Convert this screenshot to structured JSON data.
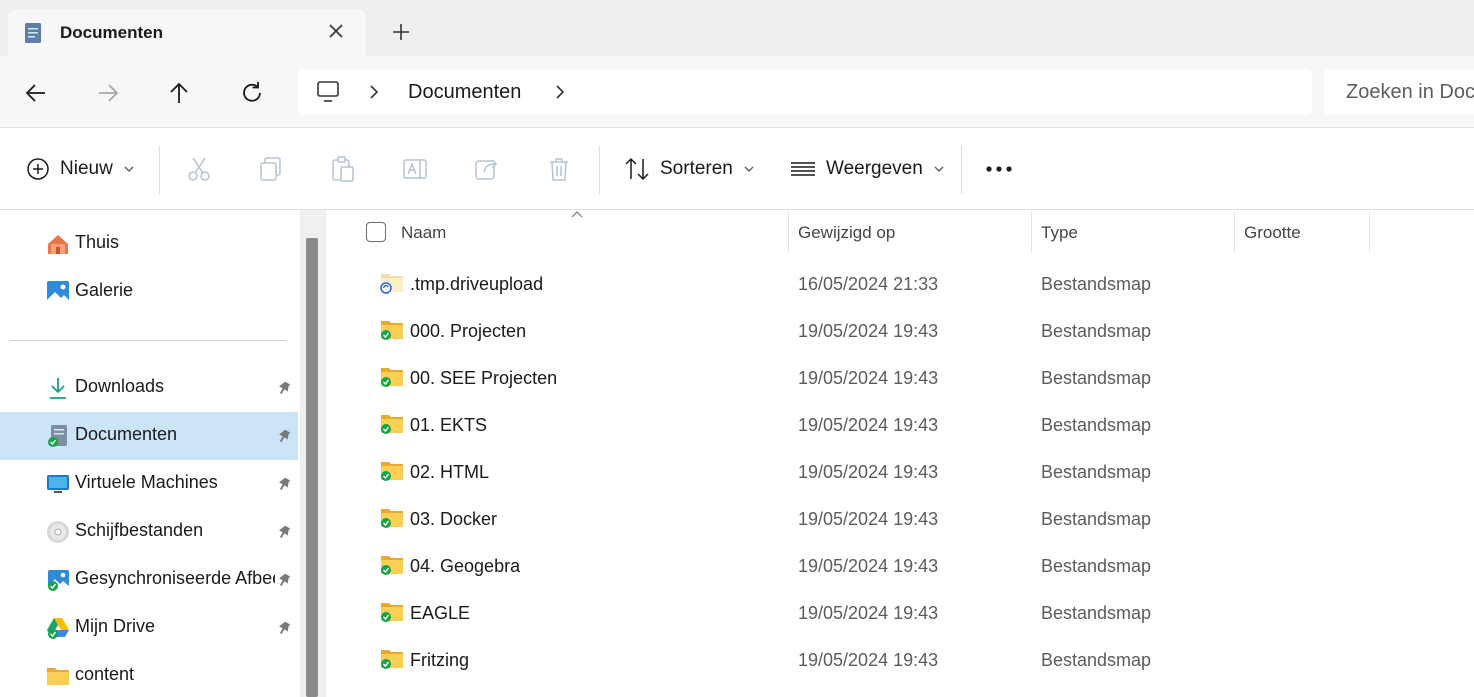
{
  "tab": {
    "title": "Documenten"
  },
  "address": {
    "crumbs": [
      "Documenten"
    ]
  },
  "search": {
    "placeholder": "Zoeken in Documenten"
  },
  "commands": {
    "new_label": "Nieuw",
    "sort_label": "Sorteren",
    "view_label": "Weergeven"
  },
  "sidebar": {
    "top_items": [
      {
        "label": "Thuis",
        "icon": "home-icon"
      },
      {
        "label": "Galerie",
        "icon": "gallery-icon"
      }
    ],
    "pinned_items": [
      {
        "label": "Downloads",
        "icon": "download-icon",
        "pinned": true
      },
      {
        "label": "Documenten",
        "icon": "documents-icon",
        "pinned": true,
        "selected": true
      },
      {
        "label": "Virtuele Machines",
        "icon": "monitor-icon",
        "pinned": true
      },
      {
        "label": "Schijfbestanden",
        "icon": "disc-icon",
        "pinned": true
      },
      {
        "label": "Gesynchroniseerde Afbeeldingen",
        "icon": "pictures-icon",
        "pinned": true
      },
      {
        "label": "Mijn Drive",
        "icon": "drive-icon",
        "pinned": true
      },
      {
        "label": "content",
        "icon": "folder-icon",
        "pinned": false
      }
    ]
  },
  "columns": {
    "name": "Naam",
    "modified": "Gewijzigd op",
    "type": "Type",
    "size": "Grootte"
  },
  "files": [
    {
      "name": ".tmp.driveupload",
      "modified": "16/05/2024 21:33",
      "type": "Bestandsmap",
      "status": "syncing"
    },
    {
      "name": "000. Projecten",
      "modified": "19/05/2024 19:43",
      "type": "Bestandsmap",
      "status": "synced"
    },
    {
      "name": "00. SEE Projecten",
      "modified": "19/05/2024 19:43",
      "type": "Bestandsmap",
      "status": "synced"
    },
    {
      "name": "01. EKTS",
      "modified": "19/05/2024 19:43",
      "type": "Bestandsmap",
      "status": "synced"
    },
    {
      "name": "02. HTML",
      "modified": "19/05/2024 19:43",
      "type": "Bestandsmap",
      "status": "synced"
    },
    {
      "name": "03. Docker",
      "modified": "19/05/2024 19:43",
      "type": "Bestandsmap",
      "status": "synced"
    },
    {
      "name": "04. Geogebra",
      "modified": "19/05/2024 19:43",
      "type": "Bestandsmap",
      "status": "synced"
    },
    {
      "name": "EAGLE",
      "modified": "19/05/2024 19:43",
      "type": "Bestandsmap",
      "status": "synced"
    },
    {
      "name": "Fritzing",
      "modified": "19/05/2024 19:43",
      "type": "Bestandsmap",
      "status": "synced"
    }
  ],
  "colors": {
    "selected_bg": "#cce4f7",
    "folder": "#f6c342",
    "synced": "#16a34a",
    "syncing": "#2563eb"
  }
}
